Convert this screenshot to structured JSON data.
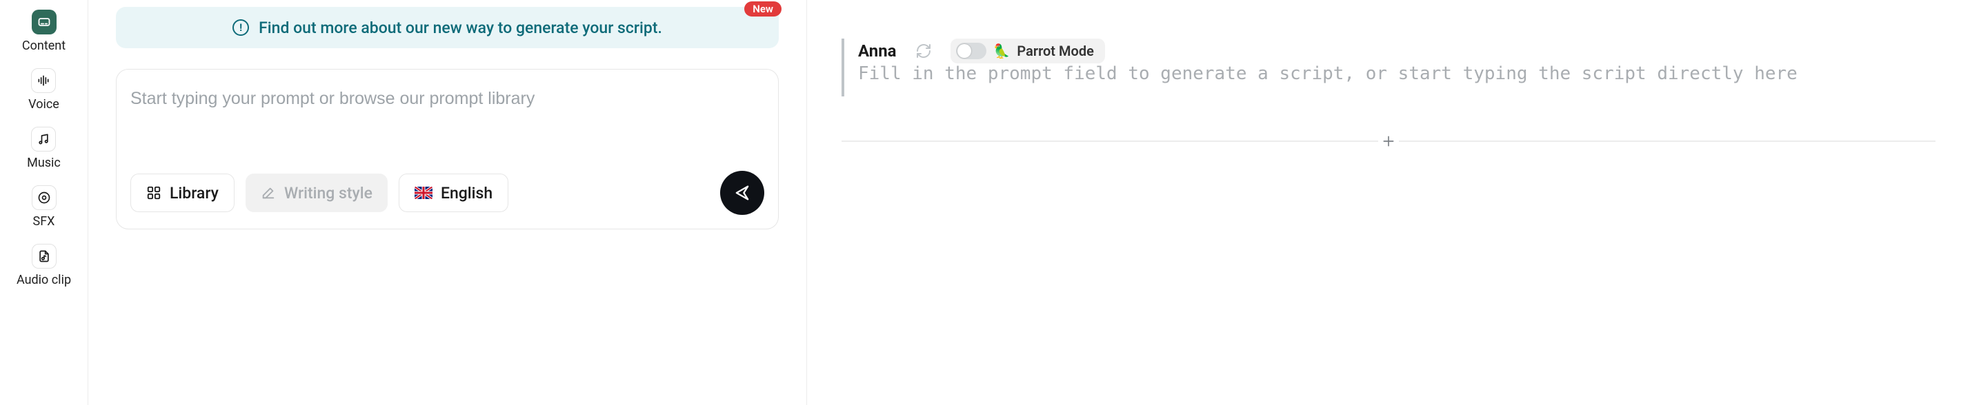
{
  "sidebar": {
    "items": [
      {
        "label": "Content"
      },
      {
        "label": "Voice"
      },
      {
        "label": "Music"
      },
      {
        "label": "SFX"
      },
      {
        "label": "Audio clip"
      }
    ]
  },
  "banner": {
    "badge": "New",
    "text": "Find out more about our new way to generate your script."
  },
  "prompt": {
    "placeholder": "Start typing your prompt or browse our prompt library",
    "library_label": "Library",
    "writing_style_label": "Writing style",
    "language_label": "English"
  },
  "voice": {
    "name": "Anna",
    "parrot_label": "Parrot Mode"
  },
  "script": {
    "placeholder": "Fill in the prompt field to generate a script, or start typing the script directly here"
  }
}
